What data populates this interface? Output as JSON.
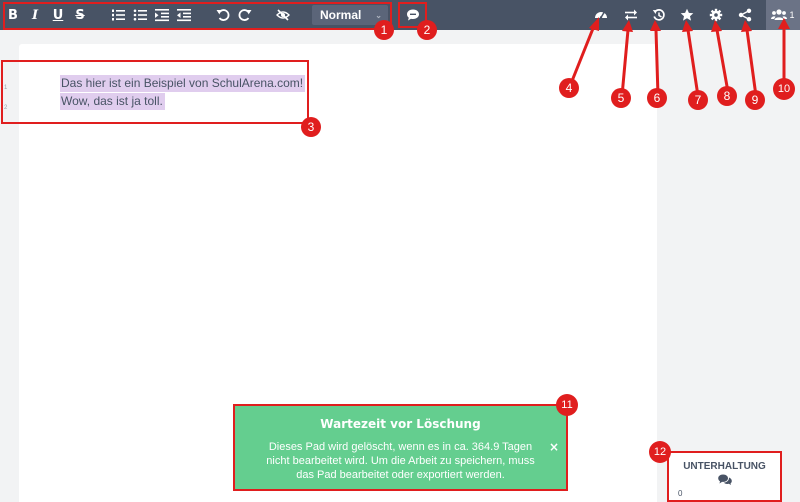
{
  "toolbar": {
    "format": {
      "bold": "B",
      "italic": "I",
      "underline": "U",
      "strike": "S"
    },
    "heading_select": {
      "value": "Normal",
      "caret": "⌄"
    },
    "icons": [
      "ordered-list-icon",
      "unordered-list-icon",
      "indent-icon",
      "outdent-icon",
      "undo-icon",
      "redo-icon",
      "hide-authorship-icon",
      "comment-icon",
      "dashboard-icon",
      "import-export-icon",
      "history-icon",
      "star-icon",
      "settings-icon",
      "share-icon",
      "users-icon"
    ],
    "user_count": "1"
  },
  "editor": {
    "line_numbers": [
      "1",
      "2"
    ],
    "lines": [
      "Das hier ist ein Beispiel von SchulArena.com!",
      "Wow, das ist ja toll."
    ]
  },
  "annotations": [
    "1",
    "2",
    "3",
    "4",
    "5",
    "6",
    "7",
    "8",
    "9",
    "10",
    "11",
    "12"
  ],
  "notification": {
    "title": "Wartezeit vor Löschung",
    "text": "Dieses Pad wird gelöscht, wenn es in ca. 364.9 Tagen nicht bearbeitet wird. Um die Arbeit zu speichern, muss das Pad bearbeitet oder exportiert werden.",
    "close": "×"
  },
  "chat": {
    "title": "UNTERHALTUNG",
    "count": "0"
  },
  "colors": {
    "toolbar": "#485365",
    "highlight": "#e0cdee",
    "notice": "#64ce8f",
    "annotation": "#e01e1e"
  }
}
